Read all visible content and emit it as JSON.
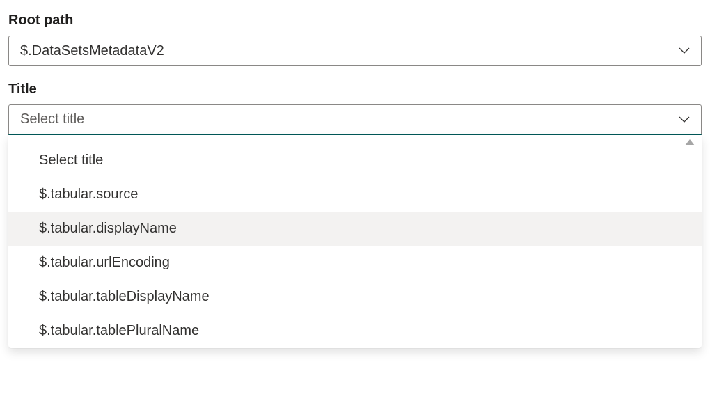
{
  "root_path": {
    "label": "Root path",
    "value": "$.DataSetsMetadataV2"
  },
  "title": {
    "label": "Title",
    "placeholder": "Select title",
    "options": [
      {
        "label": "Select title",
        "highlight": false
      },
      {
        "label": "$.tabular.source",
        "highlight": false
      },
      {
        "label": "$.tabular.displayName",
        "highlight": true
      },
      {
        "label": "$.tabular.urlEncoding",
        "highlight": false
      },
      {
        "label": "$.tabular.tableDisplayName",
        "highlight": false
      },
      {
        "label": "$.tabular.tablePluralName",
        "highlight": false
      }
    ]
  }
}
